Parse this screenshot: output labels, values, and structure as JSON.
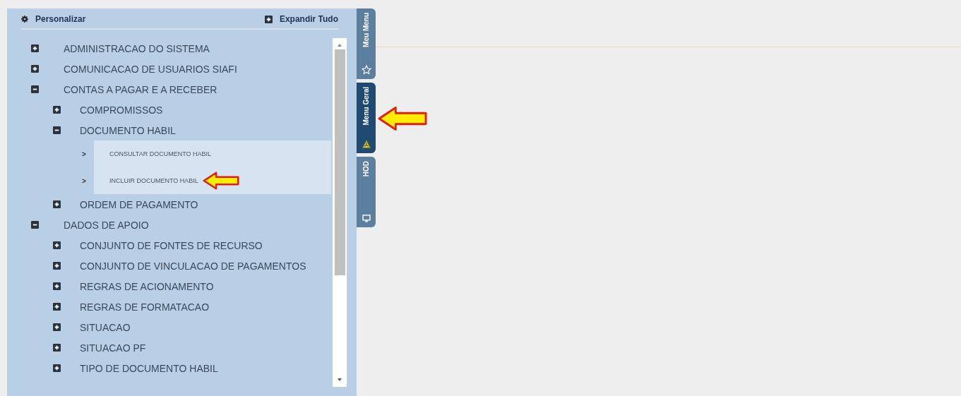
{
  "panel": {
    "customize": "Personalizar",
    "expand_all": "Expandir Tudo"
  },
  "tree": [
    {
      "label": "ADMINISTRACAO DO SISTEMA",
      "expanded": false
    },
    {
      "label": "COMUNICACAO DE USUARIOS SIAFI",
      "expanded": false
    },
    {
      "label": "CONTAS A PAGAR E A RECEBER",
      "expanded": true,
      "children": [
        {
          "label": "COMPROMISSOS",
          "expanded": false
        },
        {
          "label": "DOCUMENTO HABIL",
          "expanded": true,
          "children": [
            {
              "label": "CONSULTAR DOCUMENTO HABIL",
              "marker": ">"
            },
            {
              "label": "INCLUIR DOCUMENTO HABIL",
              "marker": ">"
            }
          ]
        },
        {
          "label": "ORDEM DE PAGAMENTO",
          "expanded": false
        }
      ]
    },
    {
      "label": "DADOS DE APOIO",
      "expanded": true,
      "children": [
        {
          "label": "CONJUNTO DE FONTES DE RECURSO",
          "expanded": false
        },
        {
          "label": "CONJUNTO DE VINCULACAO DE PAGAMENTOS",
          "expanded": false
        },
        {
          "label": "REGRAS DE ACIONAMENTO",
          "expanded": false
        },
        {
          "label": "REGRAS DE FORMATACAO",
          "expanded": false
        },
        {
          "label": "SITUACAO",
          "expanded": false
        },
        {
          "label": "SITUACAO PF",
          "expanded": false
        },
        {
          "label": "TIPO DE DOCUMENTO HABIL",
          "expanded": false
        }
      ]
    }
  ],
  "side_tabs": [
    {
      "label": "Meu Menu",
      "selected": false
    },
    {
      "label": "Menu Geral",
      "selected": true
    },
    {
      "label": "HOD",
      "selected": false
    }
  ]
}
